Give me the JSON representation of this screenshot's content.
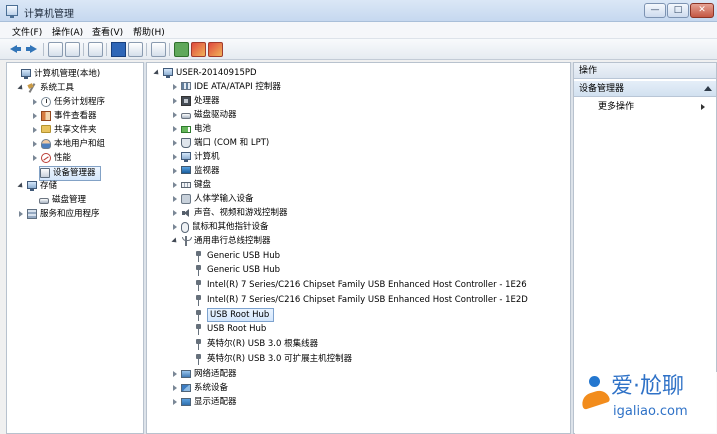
{
  "window": {
    "title": "计算机管理",
    "controls": {
      "minimize": "—",
      "maximize": "□",
      "close": "✕"
    }
  },
  "menubar": {
    "items": [
      "文件(F)",
      "操作(A)",
      "查看(V)",
      "帮助(H)"
    ]
  },
  "left_tree": {
    "items": [
      {
        "label": "计算机管理(本地)",
        "icon": "computer-icon"
      },
      {
        "label": "系统工具",
        "icon": "tools-icon"
      },
      {
        "label": "任务计划程序",
        "icon": "clock-icon"
      },
      {
        "label": "事件查看器",
        "icon": "book-icon"
      },
      {
        "label": "共享文件夹",
        "icon": "folder-icon"
      },
      {
        "label": "本地用户和组",
        "icon": "users-icon"
      },
      {
        "label": "性能",
        "icon": "performance-icon"
      },
      {
        "label": "设备管理器",
        "icon": "device-manager-icon"
      },
      {
        "label": "存储",
        "icon": "storage-icon"
      },
      {
        "label": "磁盘管理",
        "icon": "disk-icon"
      },
      {
        "label": "服务和应用程序",
        "icon": "services-icon"
      }
    ]
  },
  "device_tree": {
    "items": [
      {
        "label": "USER-20140915PD",
        "icon": "computer-icon"
      },
      {
        "label": "IDE ATA/ATAPI 控制器",
        "icon": "ide-controller-icon"
      },
      {
        "label": "处理器",
        "icon": "processor-icon"
      },
      {
        "label": "磁盘驱动器",
        "icon": "disk-drive-icon"
      },
      {
        "label": "电池",
        "icon": "battery-icon"
      },
      {
        "label": "端口 (COM 和 LPT)",
        "icon": "port-icon"
      },
      {
        "label": "计算机",
        "icon": "computer-icon"
      },
      {
        "label": "监视器",
        "icon": "monitor-icon"
      },
      {
        "label": "键盘",
        "icon": "keyboard-icon"
      },
      {
        "label": "人体学输入设备",
        "icon": "hid-icon"
      },
      {
        "label": "声音、视频和游戏控制器",
        "icon": "speaker-icon"
      },
      {
        "label": "鼠标和其他指针设备",
        "icon": "mouse-icon"
      },
      {
        "label": "通用串行总线控制器",
        "icon": "usb-controller-icon"
      },
      {
        "label": "Generic USB Hub",
        "icon": "usb-icon"
      },
      {
        "label": "Generic USB Hub",
        "icon": "usb-icon"
      },
      {
        "label": "Intel(R) 7 Series/C216 Chipset Family USB Enhanced Host Controller - 1E26",
        "icon": "usb-icon"
      },
      {
        "label": "Intel(R) 7 Series/C216 Chipset Family USB Enhanced Host Controller - 1E2D",
        "icon": "usb-icon"
      },
      {
        "label": "USB Root Hub",
        "icon": "usb-icon"
      },
      {
        "label": "USB Root Hub",
        "icon": "usb-icon"
      },
      {
        "label": "英特尔(R) USB 3.0 根集线器",
        "icon": "usb-icon"
      },
      {
        "label": "英特尔(R) USB 3.0 可扩展主机控制器",
        "icon": "usb-icon"
      },
      {
        "label": "网络适配器",
        "icon": "network-icon"
      },
      {
        "label": "系统设备",
        "icon": "system-devices-icon"
      },
      {
        "label": "显示适配器",
        "icon": "display-adapter-icon"
      }
    ]
  },
  "actions_panel": {
    "header": "操作",
    "section": "设备管理器",
    "more": "更多操作"
  },
  "watermark": {
    "cn_text": "爱·尬聊",
    "url": "igaliao.com"
  }
}
